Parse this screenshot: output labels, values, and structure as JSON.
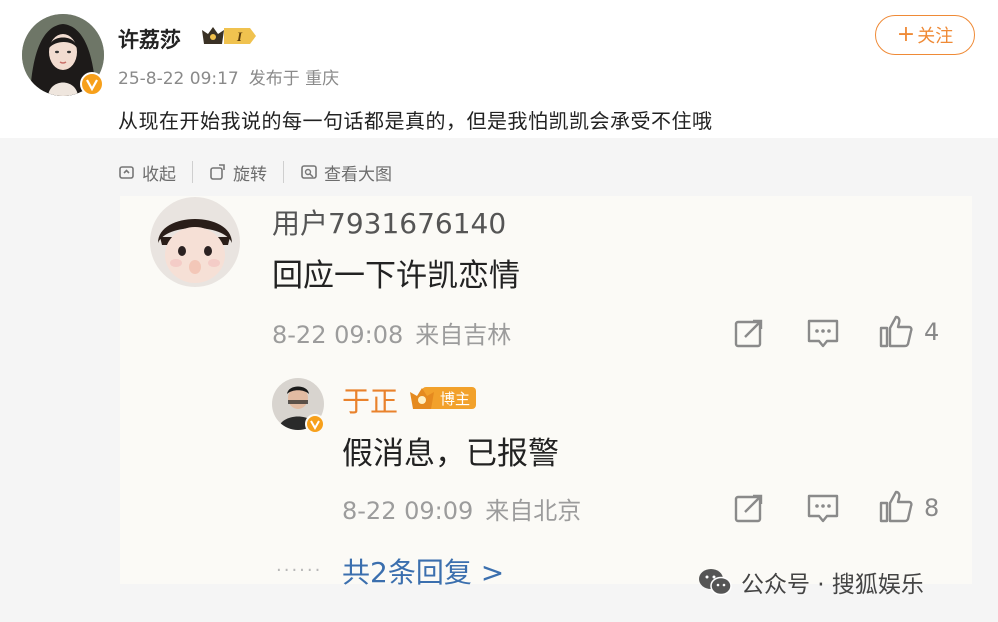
{
  "post": {
    "author": "许荔莎",
    "vip_level": "I",
    "date": "25-8-22 09:17",
    "location": "发布于 重庆",
    "follow_label": "关注",
    "follow_plus": "+",
    "text": "从现在开始我说的每一句话都是真的，但是我怕凯凯会承受不住哦"
  },
  "toolbar": {
    "collapse": "收起",
    "rotate": "旋转",
    "view_large": "查看大图"
  },
  "comment": {
    "user": "用户7931676140",
    "text": "回应一下许凯恋情",
    "date": "8-22 09:08",
    "source": "来自吉林",
    "likes": "4",
    "icons": [
      "share-icon",
      "comment-icon",
      "like-icon"
    ]
  },
  "reply": {
    "user": "于正",
    "badge": "博主",
    "text": "假消息，已报警",
    "date": "8-22 09:09",
    "source": "来自北京",
    "likes": "8"
  },
  "more_replies": "共2条回复 >",
  "dots": "......",
  "watermark": "公众号 · 搜狐娱乐",
  "colors": {
    "accent_orange": "#ef8a36",
    "link_blue": "#3b6fae",
    "verify_orange": "#f7a01b"
  }
}
